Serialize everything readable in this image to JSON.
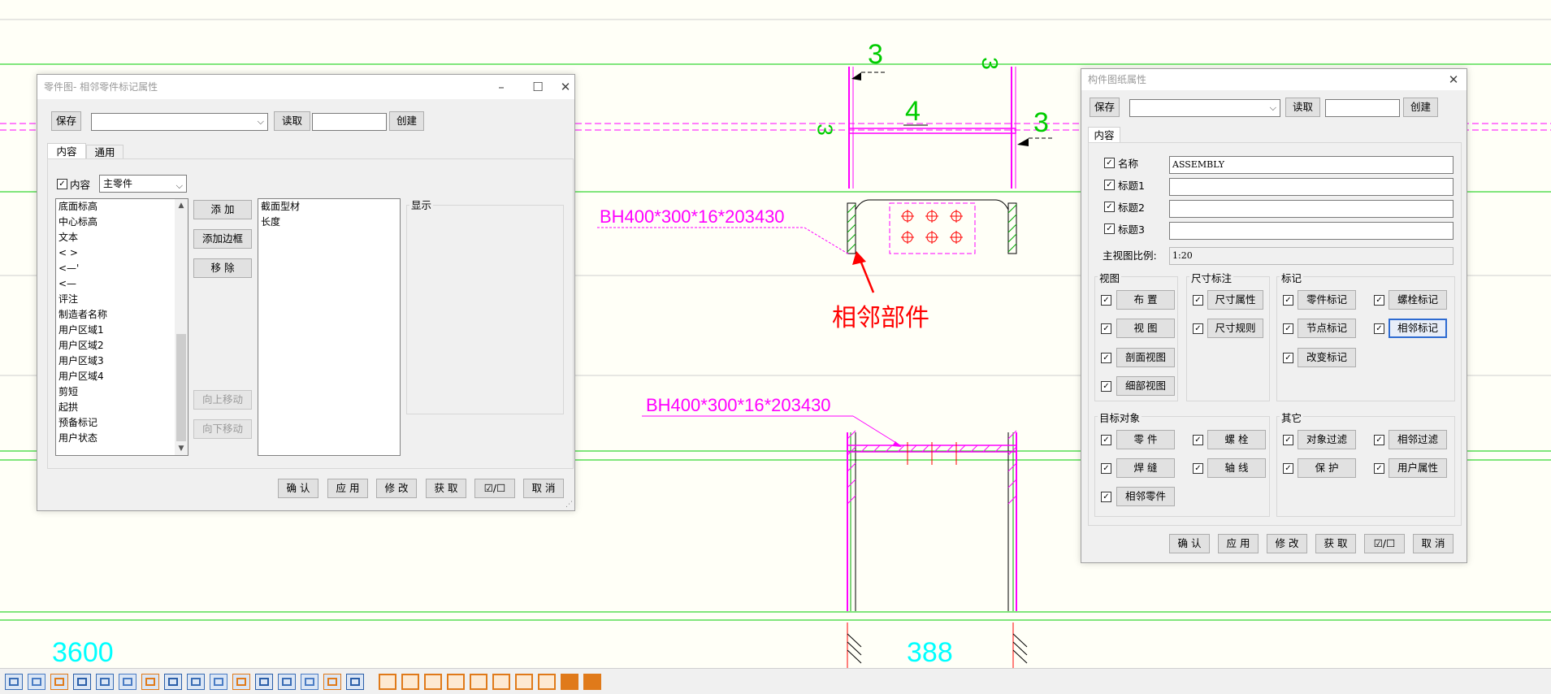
{
  "drawing": {
    "label_left_profile": "BH400*300*16*203430",
    "label_lower_profile": "BH400*300*16*203430",
    "callout": "相邻部件",
    "weld_mark_1": "3",
    "weld_mark_2": "3",
    "weld_mark_3": "3",
    "weld_mark_4": "3",
    "weld_mark_5": "4",
    "dim_left": "3600",
    "dim_center": "388",
    "colors": {
      "green": "#00cc00",
      "magenta": "#ff00ff",
      "cyan": "#00ffff",
      "red": "#ff0000",
      "gray": "#b8b8b8"
    }
  },
  "dialog_left": {
    "title": "零件图- 相邻零件标记属性",
    "save": "保存",
    "read": "读取",
    "create": "创建",
    "tabs": [
      "内容",
      "通用"
    ],
    "content_check_label": "内容",
    "content_select": "主零件",
    "available_items": [
      "底面标高",
      "中心标高",
      "文本",
      "< >",
      "<—'",
      "<—",
      "评注",
      "制造者名称",
      "用户区域1",
      "用户区域2",
      "用户区域3",
      "用户区域4",
      "剪短",
      "起拱",
      "预备标记",
      "用户状态"
    ],
    "add": "添 加",
    "add_frame": "添加边框",
    "remove": "移 除",
    "move_up": "向上移动",
    "move_down": "向下移动",
    "selected_items": [
      "截面型材",
      "长度"
    ],
    "display_label": "显示",
    "ok": "确 认",
    "apply": "应 用",
    "modify": "修 改",
    "get": "获 取",
    "toggle": "☑/☐",
    "cancel": "取 消"
  },
  "dialog_right": {
    "title": "构件图纸属性",
    "save": "保存",
    "read": "读取",
    "create": "创建",
    "tab": "内容",
    "name_label": "名称",
    "name_value": "ASSEMBLY",
    "title1_label": "标题1",
    "title2_label": "标题2",
    "title3_label": "标题3",
    "scale_label": "主视图比例:",
    "scale_value": "1:20",
    "group_view": "视图",
    "group_dim": "尺寸标注",
    "group_mark": "标记",
    "group_target": "目标对象",
    "group_other": "其它",
    "btn_layout": "布 置",
    "btn_view": "视 图",
    "btn_section": "剖面视图",
    "btn_detail": "细部视图",
    "btn_dim_attr": "尺寸属性",
    "btn_dim_rule": "尺寸规则",
    "btn_part_mark": "零件标记",
    "btn_bolt_mark": "螺栓标记",
    "btn_node_mark": "节点标记",
    "btn_adj_mark": "相邻标记",
    "btn_change_mark": "改变标记",
    "btn_part": "零 件",
    "btn_bolt": "螺 栓",
    "btn_weld": "焊 缝",
    "btn_axis": "轴 线",
    "btn_adj_part": "相邻零件",
    "btn_obj_filter": "对象过滤",
    "btn_adj_filter": "相邻过滤",
    "btn_protect": "保 护",
    "btn_user_attr": "用户属性",
    "ok": "确 认",
    "apply": "应 用",
    "modify": "修 改",
    "get": "获 取",
    "toggle": "☑/☐",
    "cancel": "取 消"
  },
  "toolbar_icons": [
    "select-icon",
    "line-icon",
    "text-icon",
    "polyline-icon",
    "rectangle-icon",
    "grid-icon",
    "swap-icon",
    "pin-icon",
    "frame-icon",
    "columns-icon",
    "beam-icon",
    "cross-hatch-icon",
    "snap-icon",
    "circle-snap-icon",
    "snap-box-icon",
    "snap-square-icon",
    "snap-center-icon",
    "snap-triangle-icon",
    "snap-cross-icon",
    "snap-end-icon",
    "snap-mid-icon",
    "snap-intersect-icon",
    "snap-line-icon",
    "snap-perpendicular-icon",
    "snap-grid-icon",
    "snap-full-icon"
  ]
}
